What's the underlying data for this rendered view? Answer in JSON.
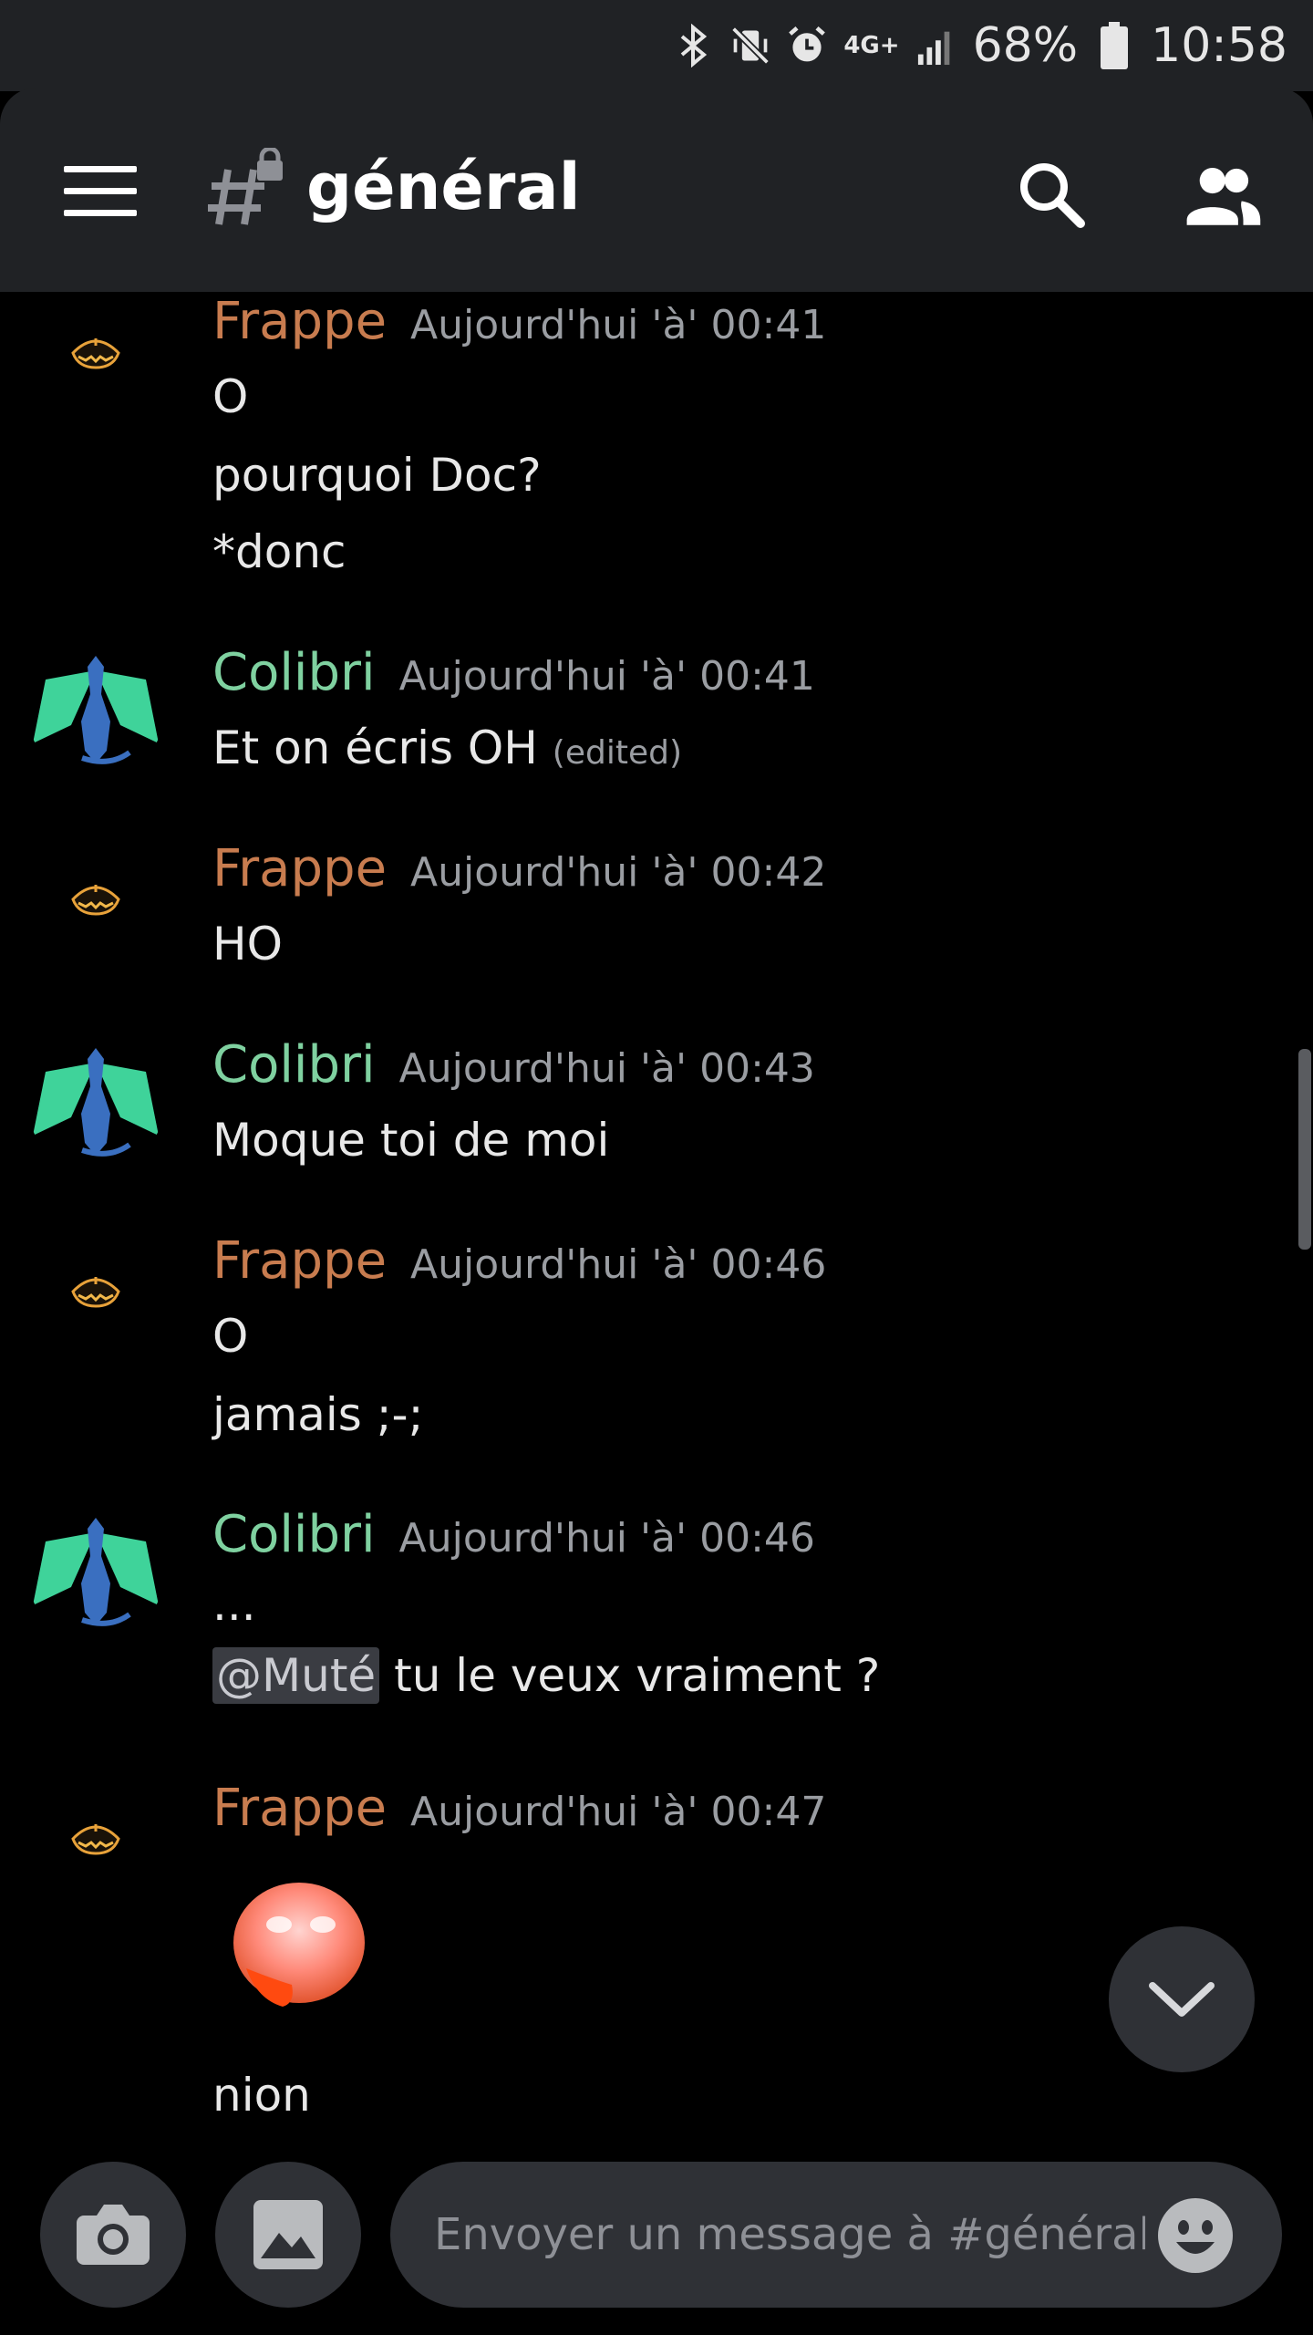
{
  "status_bar": {
    "battery": "68%",
    "time": "10:58",
    "network": "4G+",
    "icons": [
      "bluetooth-icon",
      "vibrate-icon",
      "alarm-icon",
      "signal-icon",
      "battery-icon"
    ]
  },
  "header": {
    "channel_name": "général",
    "icons": [
      "menu-icon",
      "locked-channel-icon",
      "search-icon",
      "members-icon"
    ]
  },
  "messages": [
    {
      "author": "Frappe",
      "time": "Aujourd'hui 'à' 00:41",
      "lines": [
        "O",
        "pourquoi Doc?",
        "*donc"
      ]
    },
    {
      "author": "Colibri",
      "time": "Aujourd'hui 'à' 00:41",
      "lines": [
        "Et on écris OH"
      ],
      "edited": "(edited)"
    },
    {
      "author": "Frappe",
      "time": "Aujourd'hui 'à' 00:42",
      "lines": [
        "HO"
      ]
    },
    {
      "author": "Colibri",
      "time": "Aujourd'hui 'à' 00:43",
      "lines": [
        "Moque toi de moi"
      ]
    },
    {
      "author": "Frappe",
      "time": "Aujourd'hui 'à' 00:46",
      "lines": [
        "O",
        "jamais ;-;"
      ]
    },
    {
      "author": "Colibri",
      "time": "Aujourd'hui 'à' 00:46",
      "lines": [
        "...",
        "tu le veux vraiment ?"
      ],
      "mention": "@Muté"
    },
    {
      "author": "Frappe",
      "time": "Aujourd'hui 'à' 00:47",
      "lines": [
        "nion"
      ],
      "emoji": "blushing-tongue-emoji"
    }
  ],
  "composer": {
    "placeholder": "Envoyer un message à #général",
    "icons": [
      "camera-icon",
      "image-icon",
      "emoji-icon"
    ]
  },
  "jump_button": {
    "icon": "chevron-down-icon"
  },
  "colors": {
    "background": "#000000",
    "header": "#202225",
    "frappe": "#c87c4f",
    "colibri": "#7fd1a0",
    "timestamp": "#9a9da2",
    "input": "#2f3136"
  }
}
